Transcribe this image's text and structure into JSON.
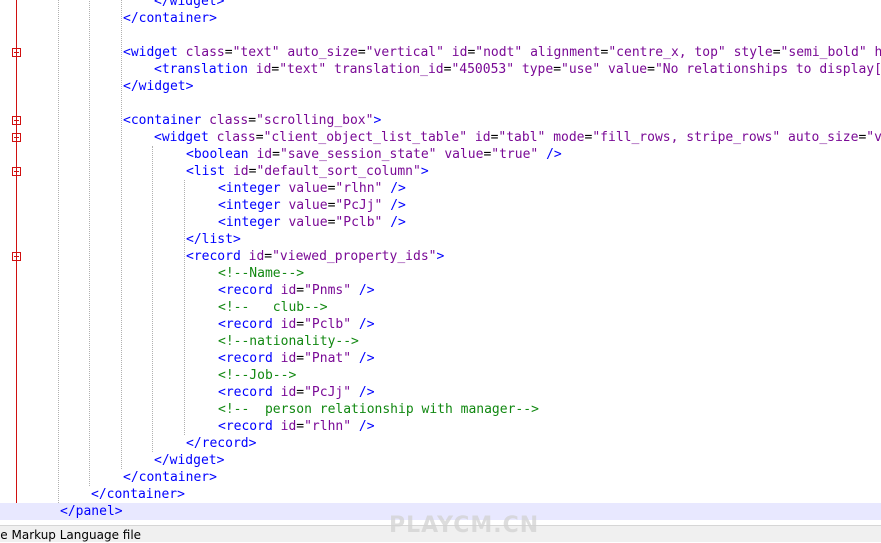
{
  "colors": {
    "tag": "#0000ff",
    "attribute": "#7a0a96",
    "comment": "#118811",
    "fold_marker": "#d01010",
    "current_line": "#e8e8ff"
  },
  "editor": {
    "lines": [
      {
        "indent": 4,
        "tokens": [
          [
            "b",
            "</widget>"
          ]
        ]
      },
      {
        "indent": 3,
        "tokens": [
          [
            "b",
            "</container>"
          ]
        ]
      },
      {
        "indent": 0,
        "tokens": []
      },
      {
        "indent": 3,
        "fold": true,
        "tokens": [
          [
            "b",
            "<widget "
          ],
          [
            "p",
            "class"
          ],
          [
            "o",
            "="
          ],
          [
            "p",
            "\"text\""
          ],
          [
            "o",
            " "
          ],
          [
            "p",
            "auto_size"
          ],
          [
            "o",
            "="
          ],
          [
            "p",
            "\"vertical\""
          ],
          [
            "o",
            " "
          ],
          [
            "p",
            "id"
          ],
          [
            "o",
            "="
          ],
          [
            "p",
            "\"nodt\""
          ],
          [
            "o",
            " "
          ],
          [
            "p",
            "alignment"
          ],
          [
            "o",
            "="
          ],
          [
            "p",
            "\"centre_x, top\""
          ],
          [
            "o",
            " "
          ],
          [
            "p",
            "style"
          ],
          [
            "o",
            "="
          ],
          [
            "p",
            "\"semi_bold\""
          ],
          [
            "o",
            " "
          ],
          [
            "p",
            "hid"
          ]
        ]
      },
      {
        "indent": 4,
        "tokens": [
          [
            "b",
            "<translation "
          ],
          [
            "p",
            "id"
          ],
          [
            "o",
            "="
          ],
          [
            "p",
            "\"text\""
          ],
          [
            "o",
            " "
          ],
          [
            "p",
            "translation_id"
          ],
          [
            "o",
            "="
          ],
          [
            "p",
            "\"450053\""
          ],
          [
            "o",
            " "
          ],
          [
            "p",
            "type"
          ],
          [
            "o",
            "="
          ],
          [
            "p",
            "\"use\""
          ],
          [
            "o",
            " "
          ],
          [
            "p",
            "value"
          ],
          [
            "o",
            "="
          ],
          [
            "p",
            "\"No relationships to display[CO"
          ]
        ]
      },
      {
        "indent": 3,
        "tokens": [
          [
            "b",
            "</widget>"
          ]
        ]
      },
      {
        "indent": 0,
        "tokens": []
      },
      {
        "indent": 3,
        "fold": true,
        "tokens": [
          [
            "b",
            "<container "
          ],
          [
            "p",
            "class"
          ],
          [
            "o",
            "="
          ],
          [
            "p",
            "\"scrolling_box\""
          ],
          [
            "b",
            ">"
          ]
        ]
      },
      {
        "indent": 4,
        "fold": true,
        "tokens": [
          [
            "b",
            "<widget "
          ],
          [
            "p",
            "class"
          ],
          [
            "o",
            "="
          ],
          [
            "p",
            "\"client_object_list_table\""
          ],
          [
            "o",
            " "
          ],
          [
            "p",
            "id"
          ],
          [
            "o",
            "="
          ],
          [
            "p",
            "\"tabl\""
          ],
          [
            "o",
            " "
          ],
          [
            "p",
            "mode"
          ],
          [
            "o",
            "="
          ],
          [
            "p",
            "\"fill_rows, stripe_rows\""
          ],
          [
            "o",
            " "
          ],
          [
            "p",
            "auto_size"
          ],
          [
            "o",
            "="
          ],
          [
            "p",
            "\"ver"
          ]
        ]
      },
      {
        "indent": 5,
        "tokens": [
          [
            "b",
            "<boolean "
          ],
          [
            "p",
            "id"
          ],
          [
            "o",
            "="
          ],
          [
            "p",
            "\"save_session_state\""
          ],
          [
            "o",
            " "
          ],
          [
            "p",
            "value"
          ],
          [
            "o",
            "="
          ],
          [
            "p",
            "\"true\""
          ],
          [
            "o",
            " "
          ],
          [
            "b",
            "/>"
          ]
        ]
      },
      {
        "indent": 5,
        "fold": true,
        "tokens": [
          [
            "b",
            "<list "
          ],
          [
            "p",
            "id"
          ],
          [
            "o",
            "="
          ],
          [
            "p",
            "\"default_sort_column\""
          ],
          [
            "b",
            ">"
          ]
        ]
      },
      {
        "indent": 6,
        "tokens": [
          [
            "b",
            "<integer "
          ],
          [
            "p",
            "value"
          ],
          [
            "o",
            "="
          ],
          [
            "p",
            "\"rlhn\""
          ],
          [
            "o",
            " "
          ],
          [
            "b",
            "/>"
          ]
        ]
      },
      {
        "indent": 6,
        "tokens": [
          [
            "b",
            "<integer "
          ],
          [
            "p",
            "value"
          ],
          [
            "o",
            "="
          ],
          [
            "p",
            "\"PcJj\""
          ],
          [
            "o",
            " "
          ],
          [
            "b",
            "/>"
          ]
        ]
      },
      {
        "indent": 6,
        "tokens": [
          [
            "b",
            "<integer "
          ],
          [
            "p",
            "value"
          ],
          [
            "o",
            "="
          ],
          [
            "p",
            "\"Pclb\""
          ],
          [
            "o",
            " "
          ],
          [
            "b",
            "/>"
          ]
        ]
      },
      {
        "indent": 5,
        "tokens": [
          [
            "b",
            "</list>"
          ]
        ]
      },
      {
        "indent": 5,
        "fold": true,
        "tokens": [
          [
            "b",
            "<record "
          ],
          [
            "p",
            "id"
          ],
          [
            "o",
            "="
          ],
          [
            "p",
            "\"viewed_property_ids\""
          ],
          [
            "b",
            ">"
          ]
        ]
      },
      {
        "indent": 6,
        "tokens": [
          [
            "g",
            "<!--Name-->"
          ]
        ]
      },
      {
        "indent": 6,
        "tokens": [
          [
            "b",
            "<record "
          ],
          [
            "p",
            "id"
          ],
          [
            "o",
            "="
          ],
          [
            "p",
            "\"Pnms\""
          ],
          [
            "o",
            " "
          ],
          [
            "b",
            "/>"
          ]
        ]
      },
      {
        "indent": 6,
        "tokens": [
          [
            "g",
            "<!--   club-->"
          ]
        ]
      },
      {
        "indent": 6,
        "tokens": [
          [
            "b",
            "<record "
          ],
          [
            "p",
            "id"
          ],
          [
            "o",
            "="
          ],
          [
            "p",
            "\"Pclb\""
          ],
          [
            "o",
            " "
          ],
          [
            "b",
            "/>"
          ]
        ]
      },
      {
        "indent": 6,
        "tokens": [
          [
            "g",
            "<!--nationality-->"
          ]
        ]
      },
      {
        "indent": 6,
        "tokens": [
          [
            "b",
            "<record "
          ],
          [
            "p",
            "id"
          ],
          [
            "o",
            "="
          ],
          [
            "p",
            "\"Pnat\""
          ],
          [
            "o",
            " "
          ],
          [
            "b",
            "/>"
          ]
        ]
      },
      {
        "indent": 6,
        "tokens": [
          [
            "g",
            "<!--Job-->"
          ]
        ]
      },
      {
        "indent": 6,
        "tokens": [
          [
            "b",
            "<record "
          ],
          [
            "p",
            "id"
          ],
          [
            "o",
            "="
          ],
          [
            "p",
            "\"PcJj\""
          ],
          [
            "o",
            " "
          ],
          [
            "b",
            "/>"
          ]
        ]
      },
      {
        "indent": 6,
        "tokens": [
          [
            "g",
            "<!--  person relationship with manager-->"
          ]
        ]
      },
      {
        "indent": 6,
        "tokens": [
          [
            "b",
            "<record "
          ],
          [
            "p",
            "id"
          ],
          [
            "o",
            "="
          ],
          [
            "p",
            "\"rlhn\""
          ],
          [
            "o",
            " "
          ],
          [
            "b",
            "/>"
          ]
        ]
      },
      {
        "indent": 5,
        "tokens": [
          [
            "b",
            "</record>"
          ]
        ]
      },
      {
        "indent": 4,
        "tokens": [
          [
            "b",
            "</widget>"
          ]
        ]
      },
      {
        "indent": 3,
        "tokens": [
          [
            "b",
            "</container>"
          ]
        ]
      },
      {
        "indent": 2,
        "tokens": [
          [
            "b",
            "</container>"
          ]
        ]
      },
      {
        "indent": 1,
        "current": true,
        "tokens": [
          [
            "b",
            "</panel>"
          ]
        ]
      }
    ]
  },
  "statusbar": {
    "file_type": "ible Markup Language file"
  },
  "watermark": "PLAYCM.CN"
}
